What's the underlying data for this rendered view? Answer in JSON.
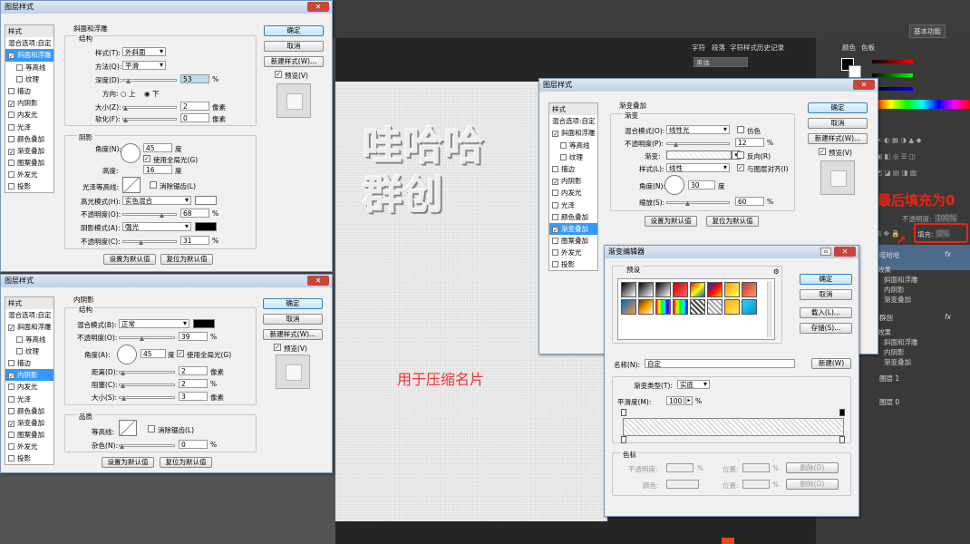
{
  "bg": {
    "workspace": "基本功能",
    "canvas_text": [
      "哇哈哈",
      "群创"
    ],
    "compress_note": "用于压缩名片",
    "right_tabs": [
      "字符",
      "段落",
      "字符样式",
      "历史记录"
    ],
    "right_tabs2": [
      "颜色",
      "色板"
    ],
    "font_field": "黑体",
    "opacity_label": "不透明度:",
    "opacity_value": "100%",
    "fill_label": "填充:",
    "fill_value": "0%",
    "annotation": "最后填充为0",
    "layers": [
      {
        "name": "哇哈哈",
        "fx": "fx",
        "effects_title": "效果",
        "effects": [
          "斜面和浮雕",
          "内阴影",
          "渐变叠加"
        ]
      },
      {
        "name": "群创",
        "fx": "fx",
        "effects_title": "效果",
        "effects": [
          "斜面和浮雕",
          "内阴影",
          "渐变叠加"
        ]
      },
      {
        "name": "图层 1"
      },
      {
        "name": "图层 0"
      }
    ]
  },
  "d1": {
    "title": "图层样式",
    "close": "✕",
    "styles": [
      "样式",
      "混合选项:自定",
      "斜面和浮雕",
      "等高线",
      "纹理",
      "描边",
      "内阴影",
      "内发光",
      "光泽",
      "颜色叠加",
      "渐变叠加",
      "图案叠加",
      "外发光",
      "投影"
    ],
    "section": "斜面和浮雕",
    "structure": "结构",
    "style_label": "样式(T):",
    "style_value": "外斜面",
    "method_label": "方法(Q):",
    "method_value": "平滑",
    "depth_label": "深度(D):",
    "depth_value": "53",
    "pct": "%",
    "dir_label": "方向:",
    "dir_up": "上",
    "dir_down": "下",
    "size_label": "大小(Z):",
    "size_value": "2",
    "px": "像素",
    "soften_label": "软化(F):",
    "soften_value": "0",
    "shading": "阴影",
    "angle_label": "角度(N):",
    "angle_value": "45",
    "deg": "度",
    "global_light": "使用全局光(G)",
    "altitude_label": "高度:",
    "altitude_value": "16",
    "gloss_label": "光泽等高线:",
    "antialias": "消除锯齿(L)",
    "hl_mode_label": "高光模式(H):",
    "hl_mode_value": "实色混合",
    "hl_color": "#ffffff",
    "hl_opacity_label": "不透明度(O):",
    "hl_opacity_value": "68",
    "sh_mode_label": "阴影模式(A):",
    "sh_mode_value": "强光",
    "sh_color": "#000000",
    "sh_opacity_label": "不透明度(C):",
    "sh_opacity_value": "31",
    "set_default": "设置为默认值",
    "reset_default": "复位为默认值",
    "ok": "确定",
    "cancel": "取消",
    "new_style": "新建样式(W)...",
    "preview": "预览(V)"
  },
  "d2": {
    "title": "图层样式",
    "close": "✕",
    "styles": [
      "样式",
      "混合选项:自定",
      "斜面和浮雕",
      "等高线",
      "纹理",
      "描边",
      "内阴影",
      "内发光",
      "光泽",
      "颜色叠加",
      "渐变叠加",
      "图案叠加",
      "外发光",
      "投影"
    ],
    "section": "内阴影",
    "structure": "结构",
    "blend_label": "混合模式(B):",
    "blend_value": "正常",
    "blend_color": "#000000",
    "opacity_label": "不透明度(O):",
    "opacity_value": "39",
    "pct": "%",
    "angle_label": "角度(A):",
    "angle_value": "45",
    "deg": "度",
    "global_light": "使用全局光(G)",
    "distance_label": "距离(D):",
    "distance_value": "2",
    "px": "像素",
    "choke_label": "阻塞(C):",
    "choke_value": "2",
    "pct2": "%",
    "size_label": "大小(S):",
    "size_value": "3",
    "quality": "品质",
    "contour_label": "等高线:",
    "antialias": "消除锯齿(L)",
    "noise_label": "杂色(N):",
    "noise_value": "0",
    "set_default": "设置为默认值",
    "reset_default": "复位为默认值",
    "ok": "确定",
    "cancel": "取消",
    "new_style": "新建样式(W)...",
    "preview": "预览(V)"
  },
  "d3": {
    "title": "图层样式",
    "close": "✕",
    "styles": [
      "样式",
      "混合选项:自定",
      "斜面和浮雕",
      "等高线",
      "纹理",
      "描边",
      "内阴影",
      "内发光",
      "光泽",
      "颜色叠加",
      "渐变叠加",
      "图案叠加",
      "外发光",
      "投影"
    ],
    "section": "渐变叠加",
    "sub": "渐变",
    "blend_label": "混合模式(O):",
    "blend_value": "线性光",
    "dither": "仿色",
    "opacity_label": "不透明度(P):",
    "opacity_value": "12",
    "pct": "%",
    "gradient_label": "渐变:",
    "reverse": "反向(R)",
    "style_label": "样式(L):",
    "style_value": "线性",
    "align": "与图层对齐(I)",
    "angle_label": "角度(N):",
    "angle_value": "30",
    "deg": "度",
    "scale_label": "缩放(S):",
    "scale_value": "60",
    "set_default": "设置为默认值",
    "reset_default": "复位为默认值",
    "ok": "确定",
    "cancel": "取消",
    "new_style": "新建样式(W)...",
    "preview": "预览(V)"
  },
  "ge": {
    "title": "渐变编辑器",
    "presets": "预设",
    "ok": "确定",
    "cancel": "取消",
    "load": "载入(L)...",
    "save": "存储(S)...",
    "name_label": "名称(N):",
    "name_value": "自定",
    "new": "新建(W)",
    "type_label": "渐变类型(T):",
    "type_value": "实底",
    "smooth_label": "平滑度(M):",
    "smooth_value": "100",
    "pct": "%",
    "stops": "色标",
    "stop_opacity": "不透明度:",
    "stop_pos": "位置:",
    "stop_del": "删除(D)",
    "stop_color": "颜色:",
    "preset_colors": [
      "#333",
      "#fff",
      "#888",
      "#c33",
      "#e80",
      "#f60",
      "#fc0",
      "#ccc",
      "#39c",
      "#909",
      "#f93",
      "#06c",
      "#fd0",
      "#eee",
      "#aaa",
      "#3cf"
    ]
  }
}
